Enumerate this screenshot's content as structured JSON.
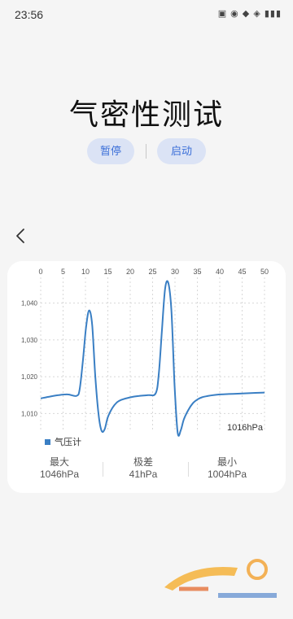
{
  "status_bar": {
    "time": "23:56",
    "icons_text": "▣ ◉ ◆ ◈ ▮▮▮"
  },
  "page": {
    "title": "气密性测试"
  },
  "controls": {
    "pause_label": "暂停",
    "start_label": "启动"
  },
  "card": {
    "current_reading": "1016hPa",
    "legend_label": "气压计",
    "stats": [
      {
        "label": "最大",
        "value": "1046hPa"
      },
      {
        "label": "极差",
        "value": "41hPa"
      },
      {
        "label": "最小",
        "value": "1004hPa"
      }
    ]
  },
  "colors": {
    "accent": "#3b6fd8",
    "series": "#3a7fc4",
    "button_bg": "#dbe3f5"
  },
  "chart_data": {
    "type": "line",
    "x_ticks": [
      "0",
      "5",
      "10",
      "15",
      "20",
      "25",
      "30",
      "35",
      "40",
      "45",
      "50"
    ],
    "y_ticks": [
      "1,010",
      "1,020",
      "1,030",
      "1,040"
    ],
    "xlim": [
      0,
      50
    ],
    "ylim": [
      1005,
      1047
    ],
    "grid": true,
    "series": [
      {
        "name": "气压计",
        "x": [
          0,
          2,
          4,
          6,
          8,
          8.7,
          9.4,
          10.1,
          10.8,
          11.5,
          12.2,
          12.9,
          13.6,
          14.3,
          15,
          16,
          17,
          18,
          20,
          22,
          24,
          25.7,
          26.4,
          27.1,
          27.8,
          28.5,
          29.2,
          29.9,
          30.6,
          31.3,
          32,
          33,
          34,
          35,
          36,
          38,
          40,
          42,
          44,
          46,
          48,
          50
        ],
        "y": [
          1014.1,
          1014.6,
          1015,
          1015.2,
          1014.8,
          1016.5,
          1024,
          1033,
          1038,
          1034,
          1020,
          1010,
          1005.3,
          1005.8,
          1009,
          1011.5,
          1013,
          1013.7,
          1014.4,
          1014.8,
          1015,
          1015.5,
          1021,
          1033,
          1044,
          1045.5,
          1038,
          1018,
          1004.8,
          1005.5,
          1008.5,
          1011,
          1012.8,
          1013.8,
          1014.4,
          1014.9,
          1015.2,
          1015.3,
          1015.4,
          1015.5,
          1015.6,
          1015.7
        ]
      }
    ]
  }
}
